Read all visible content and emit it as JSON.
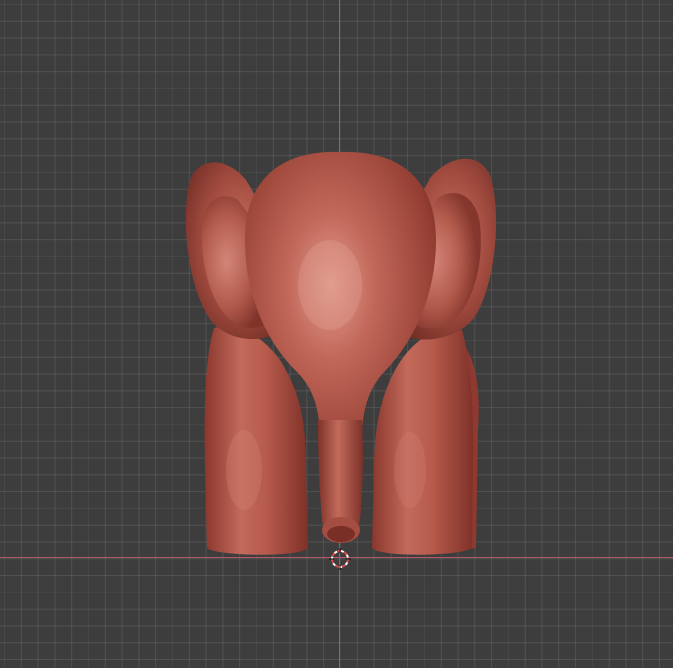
{
  "viewport": {
    "kind": "3d-viewport-front-orthographic",
    "background_color": "#3d3d3d",
    "grid": true
  },
  "axes": {
    "vertical_axis_color": "#5d7ab8",
    "horizontal_axis_color": "#b85a68"
  },
  "model": {
    "subject": "elephant-sculpt",
    "material_color": "#b65649"
  },
  "cursor": {
    "icon": "3d-cursor-icon",
    "ring_colors": [
      "#e04848",
      "#ffffff"
    ]
  }
}
